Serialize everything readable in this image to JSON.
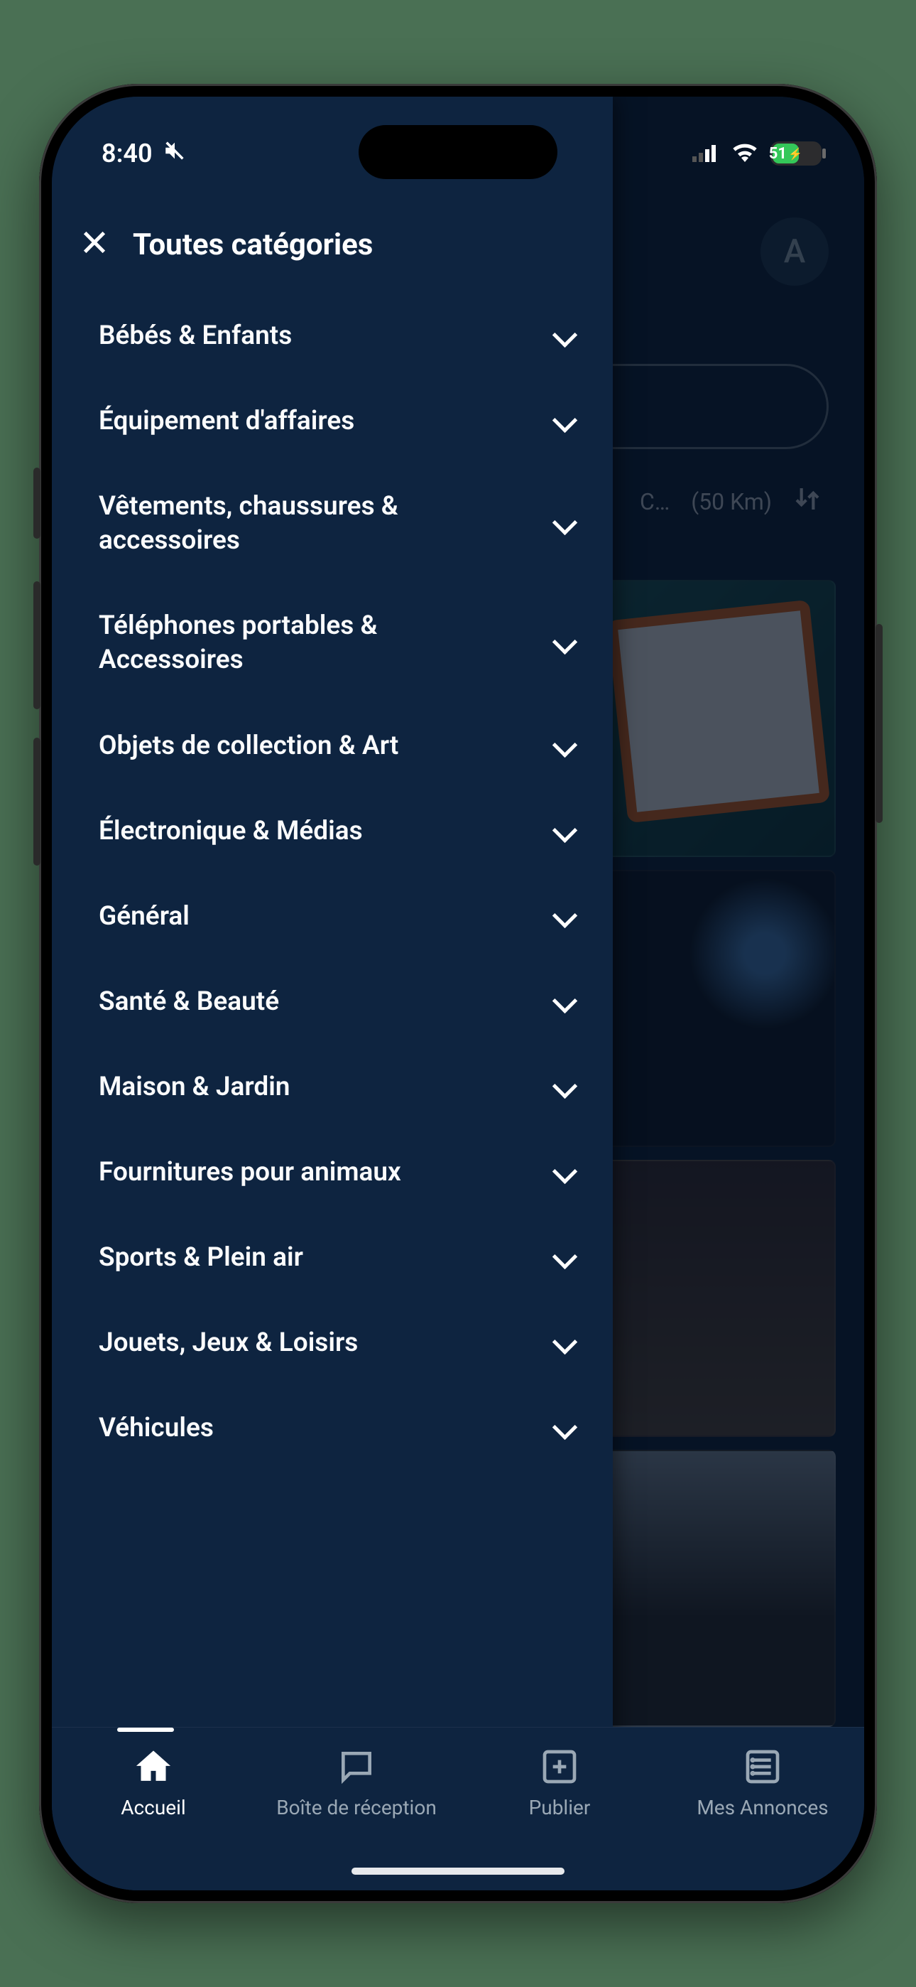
{
  "status": {
    "time": "8:40",
    "battery_percent": "51"
  },
  "header": {
    "avatar_initial": "A"
  },
  "filter": {
    "distance_label": "(50 Km)",
    "location_truncated": "C…"
  },
  "drawer": {
    "title": "Toutes catégories",
    "categories": [
      {
        "label": "Bébés & Enfants"
      },
      {
        "label": "Équipement d'affaires"
      },
      {
        "label": "Vêtements, chaussures & accessoires"
      },
      {
        "label": "Téléphones portables & Accessoires"
      },
      {
        "label": "Objets de collection & Art"
      },
      {
        "label": "Électronique & Médias"
      },
      {
        "label": "Général"
      },
      {
        "label": "Santé & Beauté"
      },
      {
        "label": "Maison & Jardin"
      },
      {
        "label": "Fournitures pour animaux"
      },
      {
        "label": "Sports & Plein air"
      },
      {
        "label": "Jouets, Jeux & Loisirs"
      },
      {
        "label": "Véhicules"
      }
    ]
  },
  "nav": {
    "items": [
      {
        "label": "Accueil",
        "active": true,
        "icon": "home"
      },
      {
        "label": "Boîte de réception",
        "active": false,
        "icon": "chat"
      },
      {
        "label": "Publier",
        "active": false,
        "icon": "plus"
      },
      {
        "label": "Mes Annonces",
        "active": false,
        "icon": "list"
      }
    ]
  }
}
